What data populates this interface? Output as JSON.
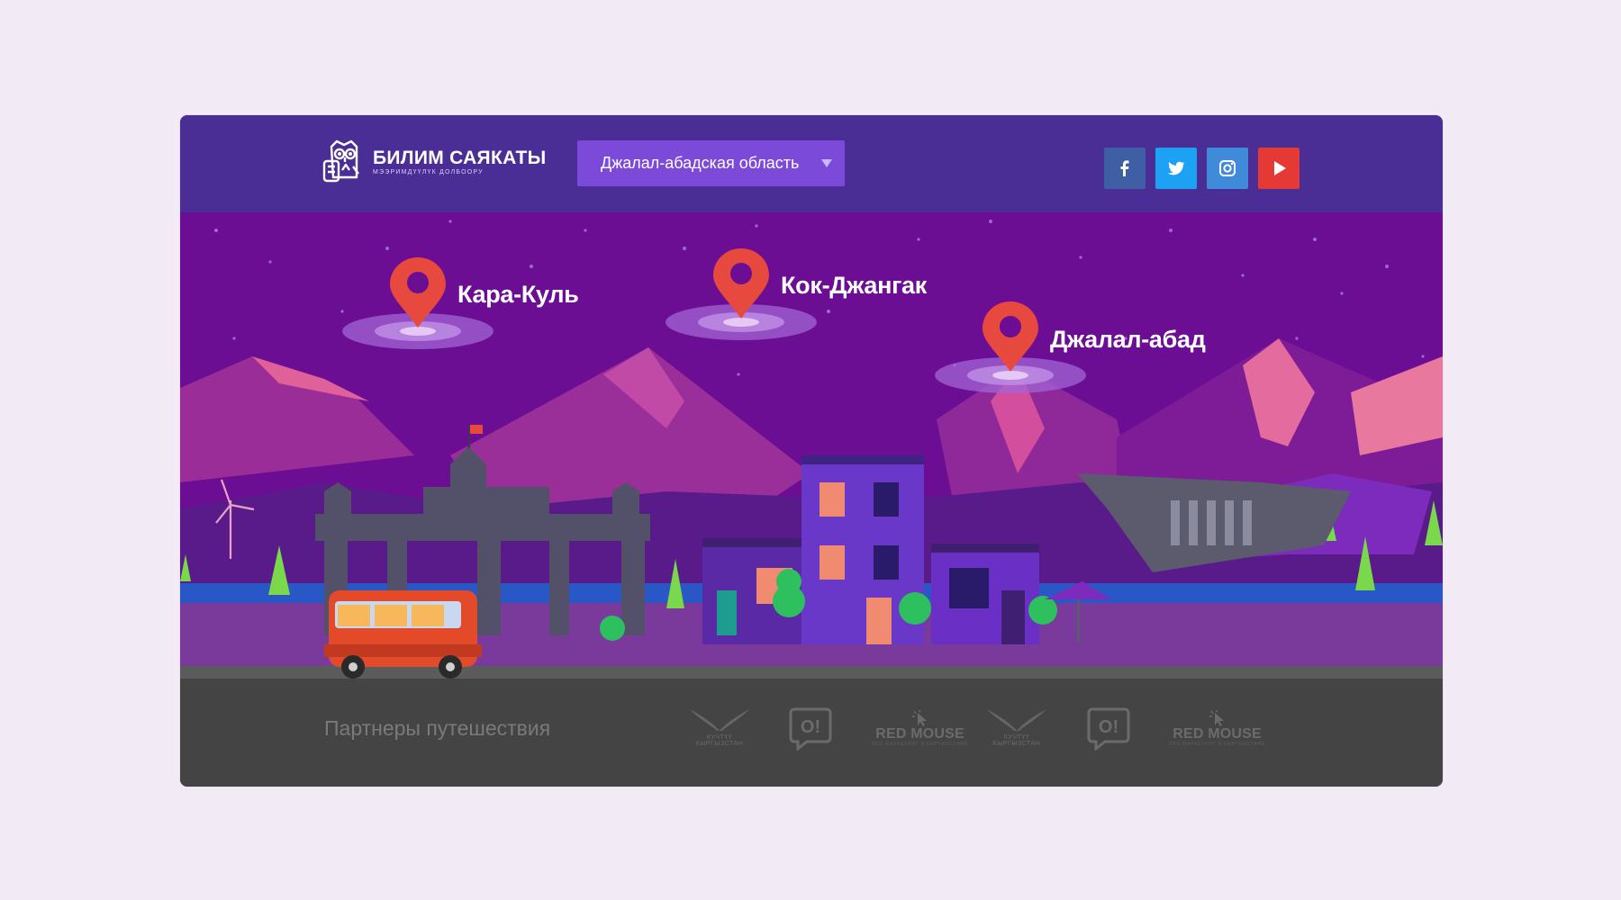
{
  "header": {
    "logo_title": "БИЛИМ САЯКАТЫ",
    "logo_subtitle": "МЭЭРИМДҮҮЛҮК ДОЛБООРУ",
    "region_select": "Джалал-абадская область"
  },
  "social": [
    {
      "name": "facebook",
      "icon": "facebook-icon",
      "color": "#3f5fa4"
    },
    {
      "name": "twitter",
      "icon": "twitter-icon",
      "color": "#1da1f2"
    },
    {
      "name": "instagram",
      "icon": "instagram-icon",
      "color": "#3f8bd9"
    },
    {
      "name": "youtube",
      "icon": "youtube-icon",
      "color": "#e53935"
    }
  ],
  "map": {
    "pins": [
      {
        "label": "Кара-Куль"
      },
      {
        "label": "Кок-Джангак"
      },
      {
        "label": "Джалал-абад"
      }
    ]
  },
  "footer": {
    "partners_title": "Партнеры путешествия",
    "partners": [
      {
        "name": "kyrgyz-eagle",
        "caption_line1": "КУЧТҮҮ",
        "caption_line2": "КЫРГЫЗСТАН"
      },
      {
        "name": "o-bubble"
      },
      {
        "name": "red-mouse",
        "label": "RED MOUSE",
        "tagline": "SEO МАРКЕТИНГ В КЫРГЫЗСТАНЕ"
      },
      {
        "name": "kyrgyz-eagle",
        "caption_line1": "КУЧТҮҮ",
        "caption_line2": "КЫРГЫЗСТАН"
      },
      {
        "name": "o-bubble"
      },
      {
        "name": "red-mouse",
        "label": "RED MOUSE",
        "tagline": "SEO МАРКЕТИНГ В КЫРГЫЗСТАНЕ"
      }
    ]
  },
  "colors": {
    "page_bg": "#f2ebf6",
    "header_bg": "#4b2e95",
    "sky": "#6b0e93",
    "select_bg": "#7b4ad9",
    "pin": "#e8493f",
    "footer_bg": "#444444"
  }
}
